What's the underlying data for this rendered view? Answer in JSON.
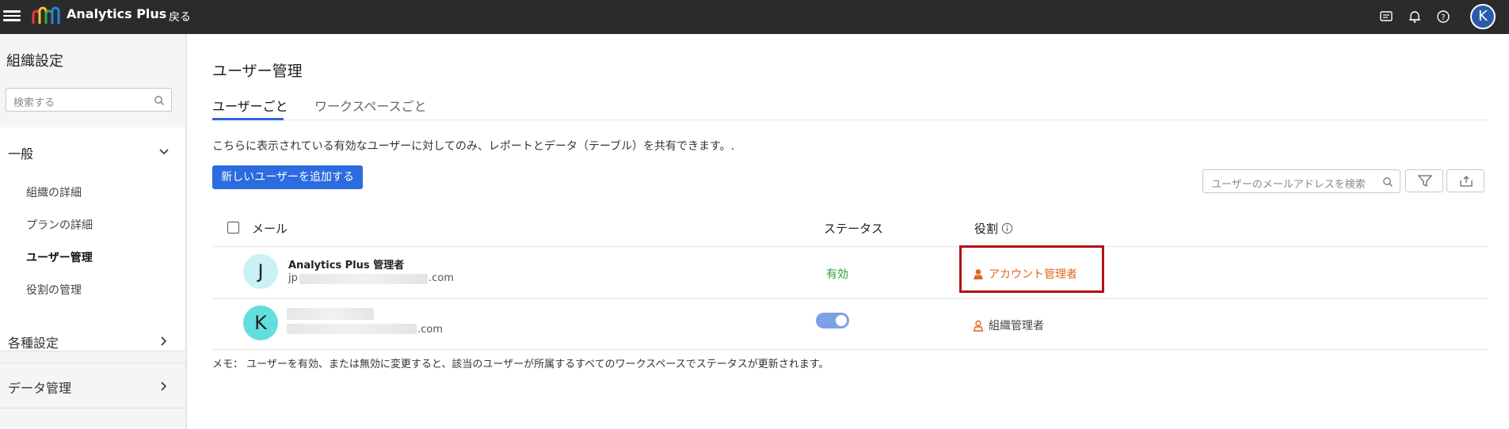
{
  "app": {
    "title": "Analytics Plus",
    "back_label": "戻る"
  },
  "topbar_icons": [
    "chat-icon",
    "bell-icon",
    "help-icon"
  ],
  "user_avatar_initial": "K",
  "sidebar": {
    "title": "組織設定",
    "search_placeholder": "検索する",
    "groups": [
      {
        "label": "一般",
        "expanded": true,
        "items": [
          {
            "label": "組織の詳細"
          },
          {
            "label": "プランの詳細"
          },
          {
            "label": "ユーザー管理",
            "active": true
          },
          {
            "label": "役割の管理"
          }
        ]
      },
      {
        "label": "各種設定",
        "expanded": false
      },
      {
        "label": "データ管理",
        "expanded": false
      }
    ]
  },
  "main": {
    "title": "ユーザー管理",
    "tabs": [
      {
        "label": "ユーザーごと",
        "active": true
      },
      {
        "label": "ワークスペースごと",
        "active": false
      }
    ],
    "notice": "こちらに表示されている有効なユーザーに対してのみ、レポートとデータ（テーブル）を共有できます。.",
    "add_user_label": "新しいユーザーを追加する",
    "email_search_placeholder": "ユーザーのメールアドレスを検索",
    "table": {
      "headers": {
        "email": "メール",
        "status": "ステータス",
        "role": "役割"
      },
      "rows": [
        {
          "initial": "J",
          "name": "Analytics Plus 管理者",
          "email_prefix": "jp",
          "email_suffix": ".com",
          "status": "有効",
          "role": "アカウント管理者",
          "avatar_color": "#c9f1f6",
          "role_color": "#e0671e"
        },
        {
          "initial": "K",
          "name": "",
          "email_prefix": "",
          "email_suffix": ".com",
          "status_toggle": true,
          "role": "組織管理者",
          "avatar_color": "#63dede",
          "role_color": "#444444"
        }
      ]
    },
    "memo": "メモ： ユーザーを有効、または無効に変更すると、該当のユーザーが所属するすべてのワークスペースでステータスが更新されます。"
  },
  "colors": {
    "accent": "#2d6be0",
    "active_status": "#2e9b3c",
    "highlight_border": "#b01212"
  }
}
